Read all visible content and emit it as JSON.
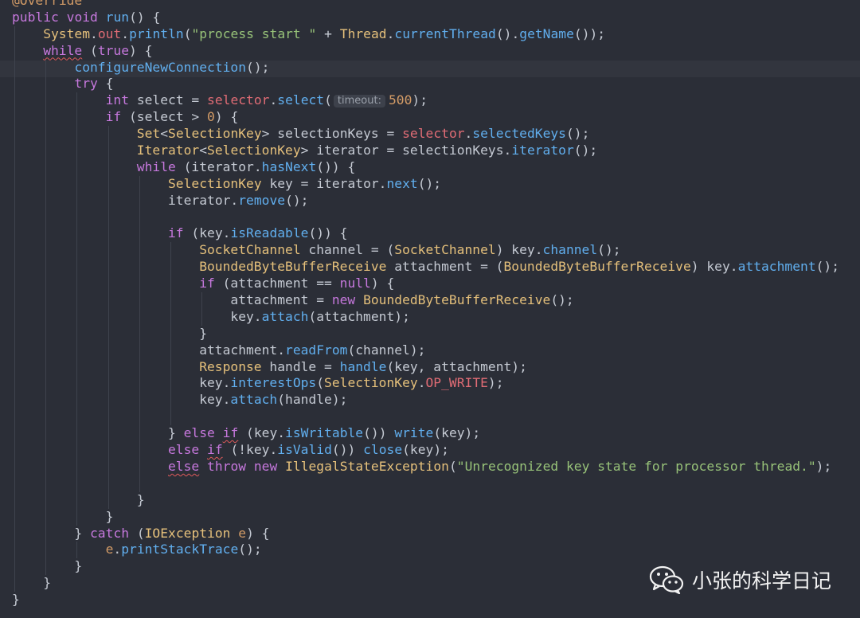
{
  "editor": {
    "lines": [
      {
        "indent": 0,
        "tokens": [
          {
            "t": "@Override",
            "c": "ann"
          }
        ]
      },
      {
        "indent": 0,
        "tokens": [
          {
            "t": "public",
            "c": "key"
          },
          {
            "t": " ",
            "c": "plain"
          },
          {
            "t": "void",
            "c": "key"
          },
          {
            "t": " ",
            "c": "plain"
          },
          {
            "t": "run",
            "c": "fn"
          },
          {
            "t": "() {",
            "c": "pun"
          }
        ]
      },
      {
        "indent": 1,
        "tokens": [
          {
            "t": "System",
            "c": "type"
          },
          {
            "t": ".",
            "c": "pun"
          },
          {
            "t": "out",
            "c": "field"
          },
          {
            "t": ".",
            "c": "pun"
          },
          {
            "t": "println",
            "c": "fn"
          },
          {
            "t": "(",
            "c": "pun"
          },
          {
            "t": "\"process start \"",
            "c": "str"
          },
          {
            "t": " + ",
            "c": "plain"
          },
          {
            "t": "Thread",
            "c": "type"
          },
          {
            "t": ".",
            "c": "pun"
          },
          {
            "t": "currentThread",
            "c": "fn"
          },
          {
            "t": "().",
            "c": "pun"
          },
          {
            "t": "getName",
            "c": "fn"
          },
          {
            "t": "());",
            "c": "pun"
          }
        ]
      },
      {
        "indent": 1,
        "tokens": [
          {
            "t": "while",
            "c": "key",
            "u": true
          },
          {
            "t": " (",
            "c": "pun"
          },
          {
            "t": "true",
            "c": "key"
          },
          {
            "t": ") {",
            "c": "pun"
          }
        ]
      },
      {
        "indent": 2,
        "tokens": [
          {
            "t": "configureNewConnection",
            "c": "fn"
          },
          {
            "t": "();",
            "c": "pun"
          }
        ]
      },
      {
        "indent": 2,
        "tokens": [
          {
            "t": "try",
            "c": "key"
          },
          {
            "t": " {",
            "c": "pun"
          }
        ]
      },
      {
        "indent": 3,
        "tokens": [
          {
            "t": "int",
            "c": "key"
          },
          {
            "t": " select = ",
            "c": "plain"
          },
          {
            "t": "selector",
            "c": "field"
          },
          {
            "t": ".",
            "c": "pun"
          },
          {
            "t": "select",
            "c": "fn"
          },
          {
            "t": "(",
            "c": "pun"
          },
          {
            "hint": "timeout:"
          },
          {
            "t": "500",
            "c": "num"
          },
          {
            "t": ");",
            "c": "pun"
          }
        ]
      },
      {
        "indent": 3,
        "tokens": [
          {
            "t": "if",
            "c": "key"
          },
          {
            "t": " (select > ",
            "c": "plain"
          },
          {
            "t": "0",
            "c": "num"
          },
          {
            "t": ") {",
            "c": "pun"
          }
        ]
      },
      {
        "indent": 4,
        "tokens": [
          {
            "t": "Set",
            "c": "type"
          },
          {
            "t": "<",
            "c": "pun"
          },
          {
            "t": "SelectionKey",
            "c": "type"
          },
          {
            "t": "> selectionKeys = ",
            "c": "plain"
          },
          {
            "t": "selector",
            "c": "field"
          },
          {
            "t": ".",
            "c": "pun"
          },
          {
            "t": "selectedKeys",
            "c": "fn"
          },
          {
            "t": "();",
            "c": "pun"
          }
        ]
      },
      {
        "indent": 4,
        "tokens": [
          {
            "t": "Iterator",
            "c": "type"
          },
          {
            "t": "<",
            "c": "pun"
          },
          {
            "t": "SelectionKey",
            "c": "type"
          },
          {
            "t": "> iterator = selectionKeys.",
            "c": "plain"
          },
          {
            "t": "iterator",
            "c": "fn"
          },
          {
            "t": "();",
            "c": "pun"
          }
        ]
      },
      {
        "indent": 4,
        "tokens": [
          {
            "t": "while",
            "c": "key"
          },
          {
            "t": " (iterator.",
            "c": "plain"
          },
          {
            "t": "hasNext",
            "c": "fn"
          },
          {
            "t": "()) {",
            "c": "pun"
          }
        ]
      },
      {
        "indent": 5,
        "tokens": [
          {
            "t": "SelectionKey",
            "c": "type"
          },
          {
            "t": " key = iterator.",
            "c": "plain"
          },
          {
            "t": "next",
            "c": "fn"
          },
          {
            "t": "();",
            "c": "pun"
          }
        ]
      },
      {
        "indent": 5,
        "tokens": [
          {
            "t": "iterator.",
            "c": "plain"
          },
          {
            "t": "remove",
            "c": "fn"
          },
          {
            "t": "();",
            "c": "pun"
          }
        ]
      },
      {
        "indent": 5,
        "tokens": []
      },
      {
        "indent": 5,
        "tokens": [
          {
            "t": "if",
            "c": "key"
          },
          {
            "t": " (key.",
            "c": "plain"
          },
          {
            "t": "isReadable",
            "c": "fn"
          },
          {
            "t": "()) {",
            "c": "pun"
          }
        ]
      },
      {
        "indent": 6,
        "tokens": [
          {
            "t": "SocketChannel",
            "c": "type"
          },
          {
            "t": " channel = (",
            "c": "plain"
          },
          {
            "t": "SocketChannel",
            "c": "type"
          },
          {
            "t": ") key.",
            "c": "plain"
          },
          {
            "t": "channel",
            "c": "fn"
          },
          {
            "t": "();",
            "c": "pun"
          }
        ]
      },
      {
        "indent": 6,
        "tokens": [
          {
            "t": "BoundedByteBufferReceive",
            "c": "type"
          },
          {
            "t": " attachment = (",
            "c": "plain"
          },
          {
            "t": "BoundedByteBufferReceive",
            "c": "type"
          },
          {
            "t": ") key.",
            "c": "plain"
          },
          {
            "t": "attachment",
            "c": "fn"
          },
          {
            "t": "();",
            "c": "pun"
          }
        ]
      },
      {
        "indent": 6,
        "tokens": [
          {
            "t": "if",
            "c": "key"
          },
          {
            "t": " (attachment == ",
            "c": "plain"
          },
          {
            "t": "null",
            "c": "key"
          },
          {
            "t": ") {",
            "c": "pun"
          }
        ]
      },
      {
        "indent": 7,
        "tokens": [
          {
            "t": "attachment = ",
            "c": "plain"
          },
          {
            "t": "new",
            "c": "key"
          },
          {
            "t": " ",
            "c": "plain"
          },
          {
            "t": "BoundedByteBufferReceive",
            "c": "type"
          },
          {
            "t": "();",
            "c": "pun"
          }
        ]
      },
      {
        "indent": 7,
        "tokens": [
          {
            "t": "key.",
            "c": "plain"
          },
          {
            "t": "attach",
            "c": "fn"
          },
          {
            "t": "(attachment);",
            "c": "pun"
          }
        ]
      },
      {
        "indent": 6,
        "tokens": [
          {
            "t": "}",
            "c": "pun"
          }
        ]
      },
      {
        "indent": 6,
        "tokens": [
          {
            "t": "attachment.",
            "c": "plain"
          },
          {
            "t": "readFrom",
            "c": "fn"
          },
          {
            "t": "(channel);",
            "c": "pun"
          }
        ]
      },
      {
        "indent": 6,
        "tokens": [
          {
            "t": "Response",
            "c": "type"
          },
          {
            "t": " handle = ",
            "c": "plain"
          },
          {
            "t": "handle",
            "c": "fn"
          },
          {
            "t": "(key, attachment);",
            "c": "pun"
          }
        ]
      },
      {
        "indent": 6,
        "tokens": [
          {
            "t": "key.",
            "c": "plain"
          },
          {
            "t": "interestOps",
            "c": "fn"
          },
          {
            "t": "(",
            "c": "pun"
          },
          {
            "t": "SelectionKey",
            "c": "type"
          },
          {
            "t": ".",
            "c": "pun"
          },
          {
            "t": "OP_WRITE",
            "c": "field"
          },
          {
            "t": ");",
            "c": "pun"
          }
        ]
      },
      {
        "indent": 6,
        "tokens": [
          {
            "t": "key.",
            "c": "plain"
          },
          {
            "t": "attach",
            "c": "fn"
          },
          {
            "t": "(handle);",
            "c": "pun"
          }
        ]
      },
      {
        "indent": 6,
        "tokens": []
      },
      {
        "indent": 5,
        "tokens": [
          {
            "t": "} ",
            "c": "pun"
          },
          {
            "t": "else",
            "c": "key"
          },
          {
            "t": " ",
            "c": "plain"
          },
          {
            "t": "if",
            "c": "key",
            "u": true
          },
          {
            "t": " (key.",
            "c": "plain"
          },
          {
            "t": "isWritable",
            "c": "fn"
          },
          {
            "t": "()) ",
            "c": "pun"
          },
          {
            "t": "write",
            "c": "fn"
          },
          {
            "t": "(key);",
            "c": "pun"
          }
        ]
      },
      {
        "indent": 5,
        "tokens": [
          {
            "t": "else",
            "c": "key"
          },
          {
            "t": " ",
            "c": "plain"
          },
          {
            "t": "if",
            "c": "key",
            "u": true
          },
          {
            "t": " (!key.",
            "c": "plain"
          },
          {
            "t": "isValid",
            "c": "fn"
          },
          {
            "t": "()) ",
            "c": "pun"
          },
          {
            "t": "close",
            "c": "fn"
          },
          {
            "t": "(key);",
            "c": "pun"
          }
        ]
      },
      {
        "indent": 5,
        "tokens": [
          {
            "t": "else",
            "c": "key",
            "u": true
          },
          {
            "t": " ",
            "c": "plain"
          },
          {
            "t": "throw",
            "c": "key"
          },
          {
            "t": " ",
            "c": "plain"
          },
          {
            "t": "new",
            "c": "key"
          },
          {
            "t": " ",
            "c": "plain"
          },
          {
            "t": "IllegalStateException",
            "c": "type"
          },
          {
            "t": "(",
            "c": "pun"
          },
          {
            "t": "\"Unrecognized key state for processor thread.\"",
            "c": "str"
          },
          {
            "t": ");",
            "c": "pun"
          }
        ]
      },
      {
        "indent": 5,
        "tokens": []
      },
      {
        "indent": 4,
        "tokens": [
          {
            "t": "}",
            "c": "pun"
          }
        ]
      },
      {
        "indent": 3,
        "tokens": [
          {
            "t": "}",
            "c": "pun"
          }
        ]
      },
      {
        "indent": 2,
        "tokens": [
          {
            "t": "} ",
            "c": "pun"
          },
          {
            "t": "catch",
            "c": "key"
          },
          {
            "t": " (",
            "c": "pun"
          },
          {
            "t": "IOException",
            "c": "type"
          },
          {
            "t": " ",
            "c": "plain"
          },
          {
            "t": "e",
            "c": "num"
          },
          {
            "t": ") {",
            "c": "pun"
          }
        ]
      },
      {
        "indent": 3,
        "tokens": [
          {
            "t": "e",
            "c": "num"
          },
          {
            "t": ".",
            "c": "pun"
          },
          {
            "t": "printStackTrace",
            "c": "fn"
          },
          {
            "t": "();",
            "c": "pun"
          }
        ]
      },
      {
        "indent": 2,
        "tokens": [
          {
            "t": "}",
            "c": "pun"
          }
        ]
      },
      {
        "indent": 1,
        "tokens": [
          {
            "t": "}",
            "c": "pun"
          }
        ]
      },
      {
        "indent": 0,
        "tokens": [
          {
            "t": "}",
            "c": "pun"
          }
        ]
      }
    ]
  },
  "watermark": {
    "text": "小张的科学日记",
    "icon": "wechat-icon"
  },
  "colors": {
    "background": "#2b2e37",
    "keyword": "#c678dd",
    "type": "#e5c07b",
    "function": "#61afef",
    "field": "#e06c75",
    "string": "#98c379",
    "number": "#d19a66"
  }
}
